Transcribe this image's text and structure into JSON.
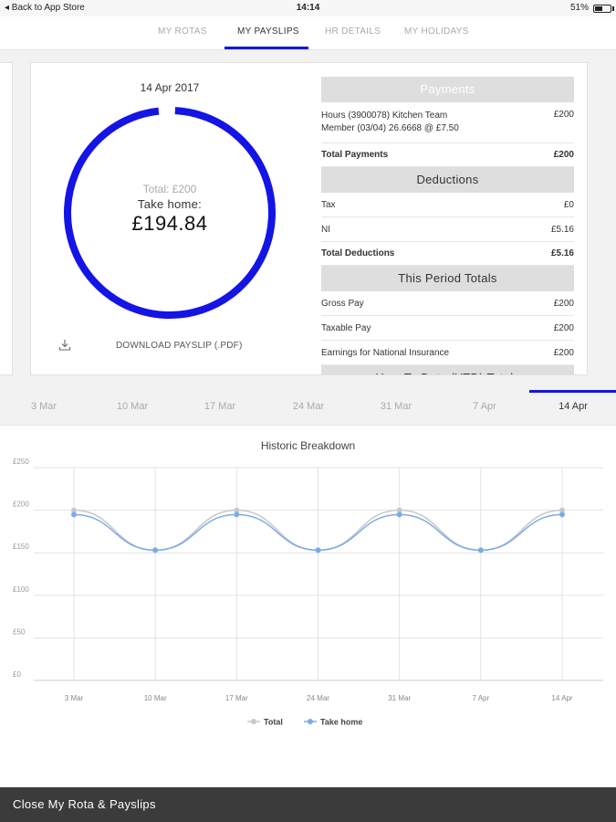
{
  "status_bar": {
    "back_label": "◂ Back to App Store",
    "time": "14:14",
    "battery": "51%",
    "battery_level": 0.51
  },
  "tabs": [
    {
      "label": "MY ROTAS",
      "active": false
    },
    {
      "label": "MY PAYSLIPS",
      "active": true
    },
    {
      "label": "HR DETAILS",
      "active": false
    },
    {
      "label": "MY HOLIDAYS",
      "active": false
    }
  ],
  "payslip": {
    "date": "14 Apr 2017",
    "total": "Total: £200",
    "take_home_label": "Take home:",
    "take_home": "£194.84",
    "download_label": "DOWNLOAD PAYSLIP (.PDF)",
    "ring_color": "#1414e6",
    "ring_fraction": 0.974
  },
  "statement": {
    "payments_title": "Payments",
    "payment_line_1": "Hours (3900078) Kitchen Team",
    "payment_line_2": "Member (03/04) 26.6668 @ £7.50",
    "payment_value": "£200",
    "total_payments_label": "Total Payments",
    "total_payments_value": "£200",
    "deductions_title": "Deductions",
    "deductions": [
      {
        "label": "Tax",
        "value": "£0"
      },
      {
        "label": "NI",
        "value": "£5.16"
      }
    ],
    "total_deductions_label": "Total Deductions",
    "total_deductions_value": "£5.16",
    "period_title": "This Period Totals",
    "period": [
      {
        "label": "Gross Pay",
        "value": "£200"
      },
      {
        "label": "Taxable Pay",
        "value": "£200"
      },
      {
        "label": "Earnings for National Insurance",
        "value": "£200"
      }
    ],
    "ytd_title": "Year To Date (YTD) Totals"
  },
  "date_strip": {
    "dates": [
      "3 Mar",
      "10 Mar",
      "17 Mar",
      "24 Mar",
      "31 Mar",
      "7 Apr",
      "14 Apr"
    ],
    "active_index": 6
  },
  "chart_data": {
    "type": "line",
    "title": "Historic Breakdown",
    "categories": [
      "3 Mar",
      "10 Mar",
      "17 Mar",
      "24 Mar",
      "31 Mar",
      "7 Apr",
      "14 Apr"
    ],
    "yticks": [
      "£0",
      "£50",
      "£100",
      "£150",
      "£200",
      "£250"
    ],
    "ylim": [
      0,
      250
    ],
    "grid": true,
    "legend_position": "bottom-center",
    "series": [
      {
        "name": "Total",
        "values": [
          200,
          153,
          200,
          153,
          200,
          153,
          200
        ],
        "color": "#c8c8c8"
      },
      {
        "name": "Take home",
        "values": [
          194.84,
          153,
          194.84,
          153,
          194.84,
          153,
          194.84
        ],
        "color": "#7cabe4"
      }
    ]
  },
  "bottom_bar": {
    "label": "Close My Rota & Payslips"
  }
}
